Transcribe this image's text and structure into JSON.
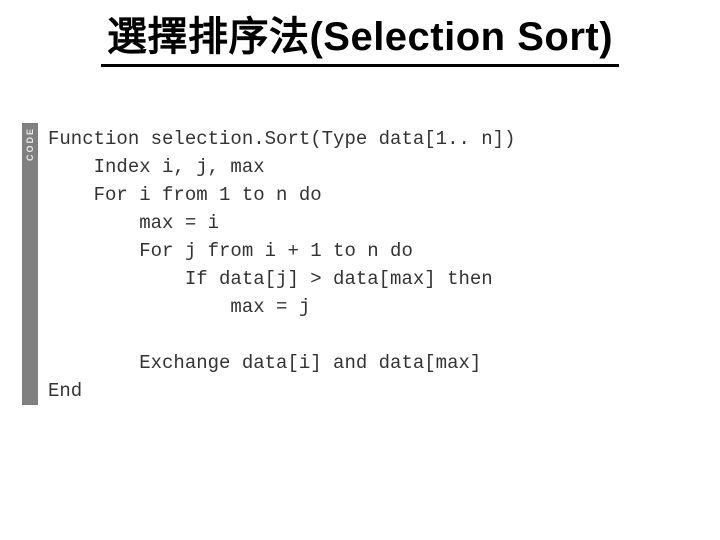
{
  "title": "選擇排序法(Selection Sort)",
  "code_label": "CODE",
  "code": {
    "l1": "Function selection.Sort(Type data[1.. n])",
    "l2": "    Index i, j, max",
    "l3": "    For i from 1 to n do",
    "l4": "        max = i",
    "l5": "        For j from i + 1 to n do",
    "l6": "            If data[j] > data[max] then",
    "l7": "                max = j",
    "l8": "",
    "l9": "        Exchange data[i] and data[max]",
    "l10": "End"
  }
}
